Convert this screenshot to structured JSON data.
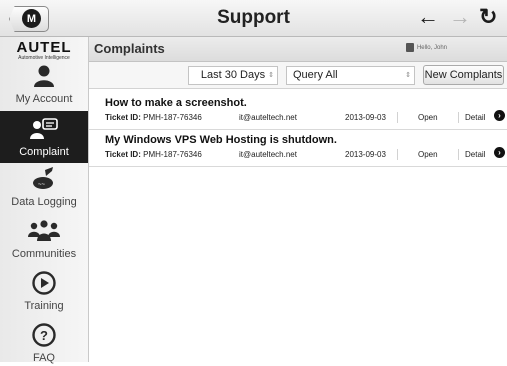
{
  "header": {
    "title": "Support",
    "home_icon_letter": "M",
    "back_icon": "arrow-left-icon",
    "forward_icon": "arrow-right-icon",
    "refresh_icon": "refresh-icon"
  },
  "sidebar": {
    "logo": {
      "brand": "AUTEL",
      "tagline": "Automotive Intelligence"
    },
    "items": [
      {
        "label": "My Account",
        "icon": "user-icon",
        "active": false
      },
      {
        "label": "Complaint",
        "icon": "complaint-icon",
        "active": true
      },
      {
        "label": "Data Logging",
        "icon": "data-logging-icon",
        "active": false
      },
      {
        "label": "Communities",
        "icon": "communities-icon",
        "active": false
      },
      {
        "label": "Training",
        "icon": "play-icon",
        "active": false
      },
      {
        "label": "FAQ",
        "icon": "question-icon",
        "active": false
      }
    ]
  },
  "content": {
    "title": "Complaints",
    "user_greeting": "Hello, John"
  },
  "filters": {
    "period": "Last 30 Days",
    "query": "Query All",
    "new_button": "New Complants"
  },
  "tickets": [
    {
      "title": "How to make a screenshot.",
      "id_label": "Ticket ID:",
      "id": "PMH-187-76346",
      "email": "it@auteltech.net",
      "date": "2013-09-03",
      "status": "Open",
      "detail": "Detail"
    },
    {
      "title": "My Windows VPS Web Hosting is shutdown.",
      "id_label": "Ticket ID:",
      "id": "PMH-187-76346",
      "email": "it@auteltech.net",
      "date": "2013-09-03",
      "status": "Open",
      "detail": "Detail"
    }
  ],
  "colors": {
    "active_sidebar_bg": "#1d1d1d",
    "sidebar_bg": "#eeeeee",
    "header_bg": "#e2e2e2"
  }
}
